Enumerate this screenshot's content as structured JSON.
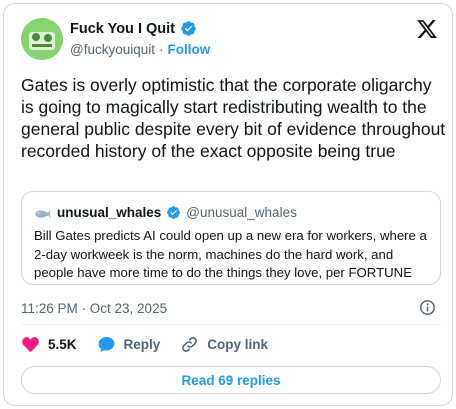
{
  "author": {
    "display_name": "Fuck You I Quit",
    "handle": "@fuckyouiquit",
    "separator": "·",
    "follow_label": "Follow"
  },
  "tweet": {
    "text": "Gates is overly optimistic that the corporate oligarchy is going to magically start redistributing wealth to the general public despite every bit of evidence throughout recorded history of the exact opposite being true"
  },
  "quote": {
    "display_name": "unusual_whales",
    "handle": "@unusual_whales",
    "text": "Bill Gates predicts AI could open up a new era for workers, where a 2-day workweek is the norm, machines do the hard work, and people have more time to do the things they love, per FORTUNE"
  },
  "meta": {
    "timestamp": "11:26 PM · Oct 23, 2025"
  },
  "actions": {
    "likes": "5.5K",
    "reply_label": "Reply",
    "copy_link_label": "Copy link"
  },
  "replies_button": {
    "label": "Read 69 replies"
  },
  "colors": {
    "accent": "#1d9bf0",
    "like": "#f91880",
    "secondary_text": "#536471",
    "border": "#cfd9de"
  },
  "icons": [
    "verified-badge-icon",
    "x-logo-icon",
    "whale-icon",
    "info-icon",
    "heart-icon",
    "reply-bubble-icon",
    "link-icon"
  ]
}
